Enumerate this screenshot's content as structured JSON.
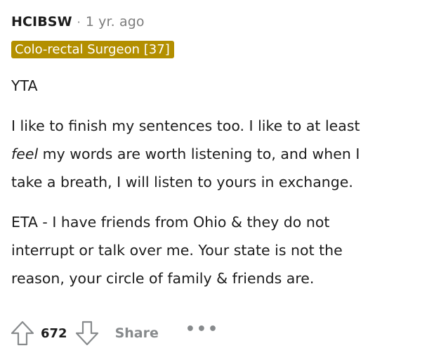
{
  "comment": {
    "author": "HCIBSW",
    "separator": "·",
    "age": "1 yr. ago",
    "flair": "Colo-rectal Surgeon [37]",
    "verdict": "YTA",
    "paragraph2": {
      "line1": "I like to finish my sentences too. I like to at least",
      "line2_em": "feel",
      "line2_rest": " my words are worth listening to, and when I",
      "line3": "take a breath, I will listen to yours in exchange."
    },
    "paragraph3": {
      "line1": "ETA - I have friends from Ohio & they do not",
      "line2": "interrupt or talk over me. Your state is not the",
      "line3": "reason, your circle of family & friends are."
    }
  },
  "actions": {
    "upvote_icon": "upvote-arrow-icon",
    "score": "672",
    "downvote_icon": "downvote-arrow-icon",
    "share_label": "Share",
    "more_label": "•••"
  },
  "colors": {
    "flair_bg": "#b38f00",
    "text": "#1c1c1c",
    "muted": "#7c7c7c",
    "action_grey": "#878a8c"
  }
}
